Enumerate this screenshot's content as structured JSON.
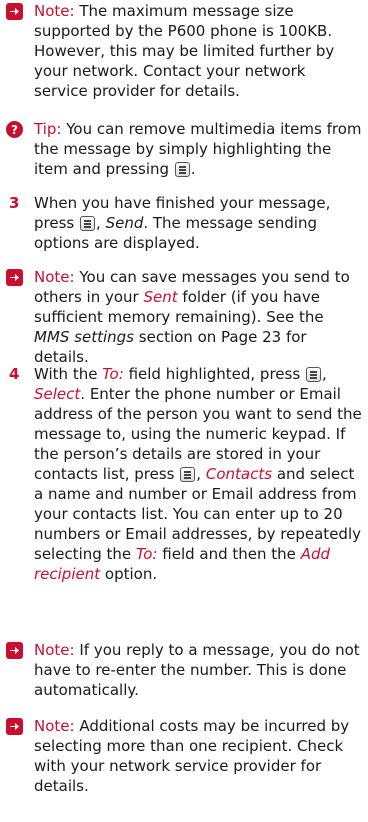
{
  "items": [
    {
      "kind": "note",
      "label": "Note:",
      "text": "The maximum message size supported by the P600 phone is 100KB. However, this may be limited further by your network. Contact your network service provider for details."
    },
    {
      "kind": "tip",
      "label": "Tip:",
      "text_before": "You can remove multimedia items from the message by simply highlighting the item and pressing",
      "text_after": "."
    },
    {
      "kind": "step",
      "num": "3",
      "t1": "When you have finished your message, press",
      "t2": ",",
      "send": "Send",
      "t3": ". The message sending options are displayed."
    },
    {
      "kind": "note",
      "label": "Note:",
      "t1": "You can save messages you send to others in your",
      "sent": "Sent",
      "t2": "folder (if you have sufficient memory remaining). See the",
      "mms": "MMS settings",
      "t3": "section on Page 23 for details."
    },
    {
      "kind": "step",
      "num": "4",
      "t1": "With the",
      "to": "To:",
      "t2": "field highlighted, press",
      "t3": ",",
      "select": "Select",
      "t4": ". Enter the phone number or Email address of the person you want to send the message to, using the numeric keypad. If the person’s details are stored in your contacts list, press",
      "t5": ",",
      "contacts": "Contacts",
      "t6": "and select a name and number or Email address from your contacts list. You can enter up to 20 numbers or Email addresses, by repeatedly selecting the",
      "to2": "To:",
      "t7": "field and then the",
      "add": "Add recipient",
      "t8": "option."
    },
    {
      "kind": "note",
      "label": "Note:",
      "text": "If you reply to a message, you do not have to re-enter the number. This is done automatically."
    },
    {
      "kind": "note",
      "label": "Note:",
      "text": "Additional costs may be incurred by selecting more than one recipient. Check with your network service provider for details."
    }
  ],
  "colors": {
    "accent": "#c8102e",
    "text": "#1a1a1a"
  },
  "icons": {
    "note": "arrow-right-icon",
    "tip": "question-icon",
    "key": "menu-key-icon"
  }
}
